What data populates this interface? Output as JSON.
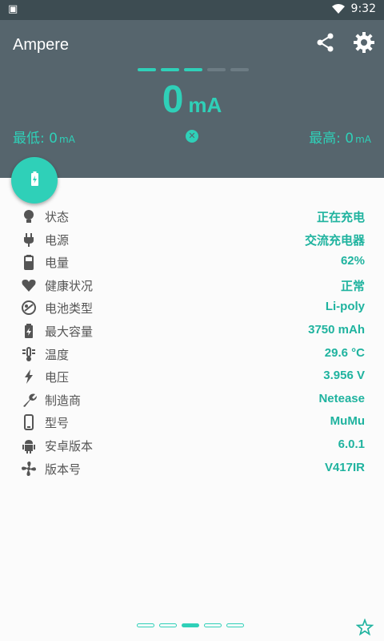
{
  "status_bar": {
    "left_icon": "notification-icon",
    "time": "9:32"
  },
  "header": {
    "title": "Ampere",
    "share_icon": "share-icon",
    "settings_icon": "gear-icon",
    "current_value": "0",
    "current_unit": "mA",
    "min_label": "最低: 0",
    "min_unit": "mA",
    "max_label": "最高: 0",
    "max_unit": "mA",
    "level_dashes_filled": 3,
    "level_dashes_total": 5
  },
  "battery_info": [
    {
      "icon": "lightbulb-icon",
      "label": "状态",
      "value": "正在充电"
    },
    {
      "icon": "plug-icon",
      "label": "电源",
      "value": "交流充电器"
    },
    {
      "icon": "battery-icon",
      "label": "电量",
      "value": "62%"
    },
    {
      "icon": "heart-icon",
      "label": "健康状况",
      "value": "正常"
    },
    {
      "icon": "chemistry-icon",
      "label": "电池类型",
      "value": "Li-poly"
    },
    {
      "icon": "battery-charging-icon",
      "label": "最大容量",
      "value": "3750 mAh"
    },
    {
      "icon": "thermometer-icon",
      "label": "温度",
      "value": "29.6 °C"
    },
    {
      "icon": "bolt-icon",
      "label": "电压",
      "value": "3.956 V"
    },
    {
      "icon": "wrench-icon",
      "label": "制造商",
      "value": "Netease"
    },
    {
      "icon": "phone-icon",
      "label": "型号",
      "value": "MuMu"
    },
    {
      "icon": "android-icon",
      "label": "安卓版本",
      "value": "6.0.1"
    },
    {
      "icon": "fan-icon",
      "label": "版本号",
      "value": "V417IR"
    }
  ],
  "pager": {
    "pages": 5,
    "active": 2
  },
  "colors": {
    "accent": "#2fd0b8",
    "header_bg": "#56656d",
    "status_bar_bg": "#3d4c52",
    "value_text": "#1fb39f"
  }
}
